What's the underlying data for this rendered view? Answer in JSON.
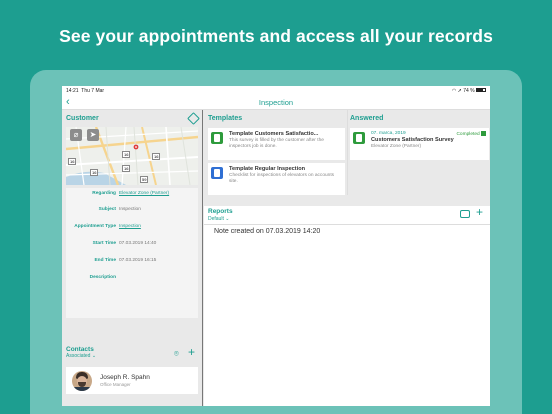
{
  "headline": "See your appointments and access all your records",
  "status": {
    "time": "14:21",
    "date": "Thu 7 Mar",
    "battery": "74 %"
  },
  "nav": {
    "title": "Inspection"
  },
  "customer": {
    "title": "Customer"
  },
  "map": {
    "road_labels": [
      "16",
      "16",
      "16",
      "16",
      "16",
      "59"
    ]
  },
  "fields": [
    {
      "label": "Regarding",
      "value": "Elevator Zone (Partner)",
      "link": true
    },
    {
      "label": "Subject",
      "value": "Inspection",
      "link": false
    },
    {
      "label": "Appointment Type",
      "value": "Inspection",
      "link": true
    },
    {
      "label": "Start Time",
      "value": "07.03.2019 14:40",
      "link": false
    },
    {
      "label": "End Time",
      "value": "07.03.2019 16:15",
      "link": false
    },
    {
      "label": "Description",
      "value": "",
      "link": false
    }
  ],
  "contacts": {
    "title": "Contacts",
    "filter": "Associated",
    "name": "Joseph R. Spahn",
    "role": "Office Manager"
  },
  "templates": {
    "title": "Templates",
    "items": [
      {
        "title": "Template Customers Satisfactio...",
        "desc": "This survey is filled by the customer after the inspectors job is done."
      },
      {
        "title": "Template Regular Inspection",
        "desc": "Checklist for inspections of elevators on accounts site."
      }
    ]
  },
  "answered": {
    "title": "Answered",
    "date": "07. marca, 2019",
    "status": "Completed",
    "name": "Customers Satisfaction Survey",
    "account": "Elevator Zone (Partner)"
  },
  "reports": {
    "title": "Reports",
    "filter": "Default",
    "note": "Note created on 07.03.2019 14:20"
  },
  "colors": {
    "brand": "#1d9e90",
    "completed": "#2e9b3c"
  }
}
